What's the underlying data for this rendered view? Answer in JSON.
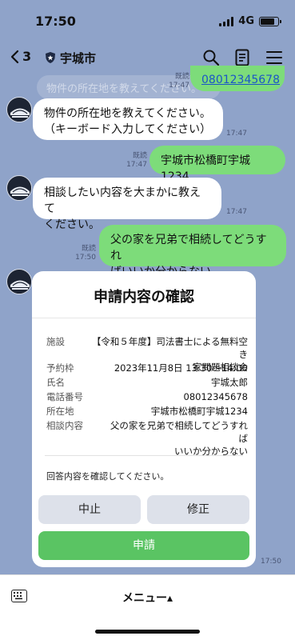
{
  "status": {
    "time": "17:50",
    "network": "4G"
  },
  "header": {
    "back_count": "3",
    "room_name": "宇城市",
    "ghost_text": "物件の所在地を教えてください。"
  },
  "messages": {
    "m1": {
      "text": "08012345678",
      "read": "既読",
      "time": "17:47"
    },
    "m2": {
      "line1": "物件の所在地を教えてください。",
      "line2": "（キーボード入力してください）",
      "time": "17:47"
    },
    "m3": {
      "text": "宇城市松橋町宇城1234",
      "read": "既読",
      "time": "17:47"
    },
    "m4": {
      "line1": "相談したい内容を大まかに教えて",
      "line2": "ください。",
      "time": "17:47"
    },
    "m5": {
      "line1": "父の家を兄弟で相続してどうすれ",
      "line2": "ばいいか分からない",
      "read": "既読",
      "time": "17:50"
    },
    "card_time": "17:50"
  },
  "card": {
    "title": "申請内容の確認",
    "rows": [
      {
        "label": "施設",
        "value1": "【令和５年度】司法書士による無料空き",
        "value2": "家問題相談会"
      },
      {
        "label": "予約枠",
        "value1": "2023年11月8日 13:30～14:00"
      },
      {
        "label": "氏名",
        "value1": "宇城太郎"
      },
      {
        "label": "電話番号",
        "value1": "08012345678"
      },
      {
        "label": "所在地",
        "value1": "宇城市松橋町宇城1234"
      },
      {
        "label": "相談内容",
        "value1": "父の家を兄弟で相続してどうすれば",
        "value2": "いいか分からない"
      }
    ],
    "confirm_text": "回答内容を確認してください。",
    "cancel_label": "中止",
    "edit_label": "修正",
    "submit_label": "申請"
  },
  "bottom": {
    "menu_label": "メニュー▴"
  },
  "colors": {
    "background": "#8fa3c9",
    "outgoing": "#7ddc7a",
    "submit": "#5ac463",
    "link": "#1b55c7"
  },
  "icons": [
    "chevron-left-icon",
    "shield-icon",
    "search-icon",
    "notes-icon",
    "hamburger-menu-icon",
    "keyboard-icon"
  ]
}
